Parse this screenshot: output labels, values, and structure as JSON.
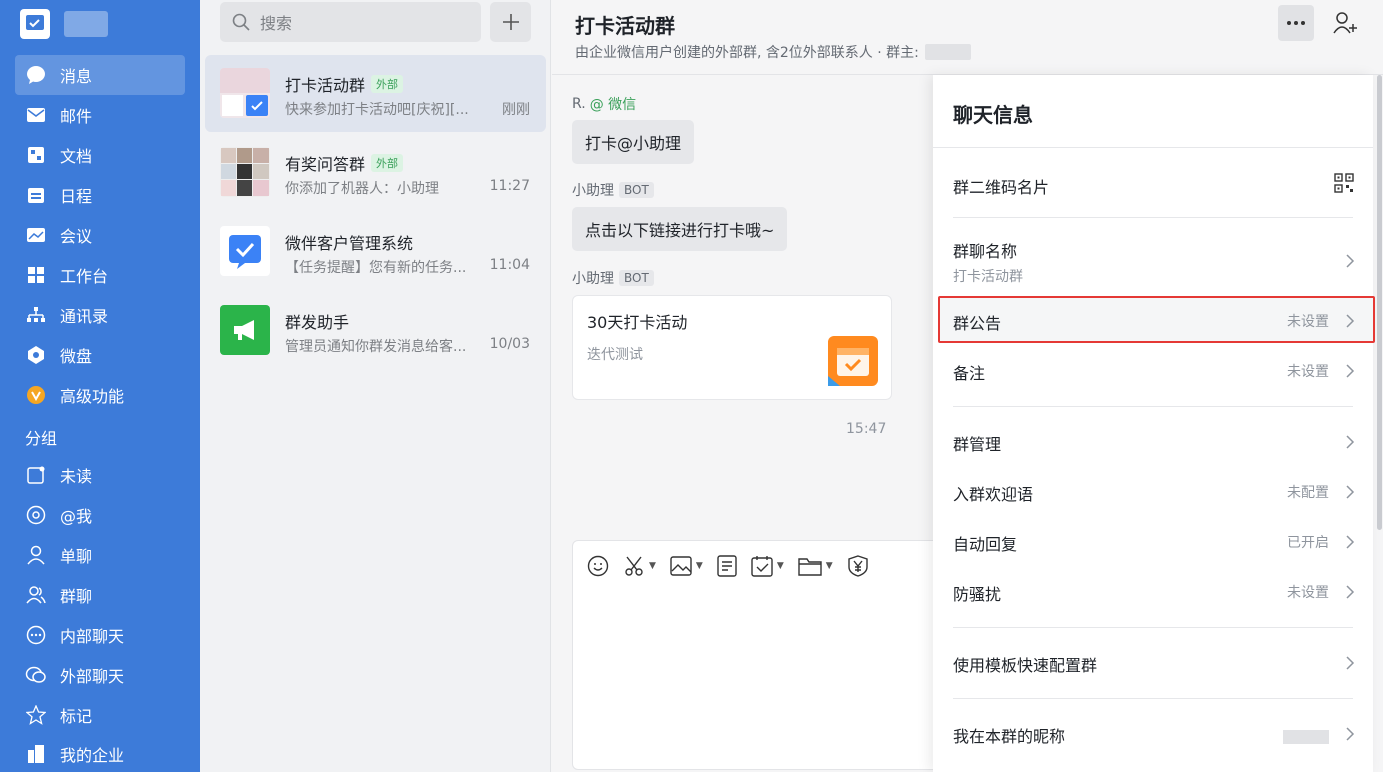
{
  "colors": {
    "sidebar": "#3d7bd9",
    "accent_green": "#3aa05a",
    "highlight_border": "#e53935"
  },
  "sidebar": {
    "nav": [
      {
        "label": "消息",
        "icon": "chat-bubble-icon"
      },
      {
        "label": "邮件",
        "icon": "mail-icon"
      },
      {
        "label": "文档",
        "icon": "document-icon"
      },
      {
        "label": "日程",
        "icon": "calendar-icon"
      },
      {
        "label": "会议",
        "icon": "meeting-icon"
      },
      {
        "label": "工作台",
        "icon": "grid-icon"
      },
      {
        "label": "通讯录",
        "icon": "org-chart-icon"
      },
      {
        "label": "微盘",
        "icon": "drive-icon"
      },
      {
        "label": "高级功能",
        "icon": "premium-icon"
      }
    ],
    "group_label": "分组",
    "groups": [
      {
        "label": "未读",
        "icon": "unread-icon"
      },
      {
        "label": "@我",
        "icon": "at-icon"
      },
      {
        "label": "单聊",
        "icon": "person-icon"
      },
      {
        "label": "群聊",
        "icon": "group-icon"
      },
      {
        "label": "内部聊天",
        "icon": "dots-chat-icon"
      },
      {
        "label": "外部聊天",
        "icon": "external-chat-icon"
      },
      {
        "label": "标记",
        "icon": "star-icon"
      },
      {
        "label": "我的企业",
        "icon": "building-icon"
      }
    ]
  },
  "convlist": {
    "search_placeholder": "搜索",
    "items": [
      {
        "name": "打卡活动群",
        "tag": "外部",
        "preview": "快来参加打卡活动吧[庆祝][...",
        "time": "刚刚"
      },
      {
        "name": "有奖问答群",
        "tag": "外部",
        "preview": "你添加了机器人：小助理",
        "time": "11:27"
      },
      {
        "name": "微伴客户管理系统",
        "tag": "",
        "preview": "【任务提醒】您有新的任务...",
        "time": "11:04"
      },
      {
        "name": "群发助手",
        "tag": "",
        "preview": "管理员通知你群发消息给客...",
        "time": "10/03"
      }
    ]
  },
  "chat": {
    "title": "打卡活动群",
    "subtitle": "由企业微信用户创建的外部群, 含2位外部联系人 · 群主:",
    "messages": [
      {
        "sender": "R.",
        "source": "@ 微信",
        "text": "打卡@小助理"
      },
      {
        "sender": "小助理",
        "badge": "BOT",
        "text": "点击以下链接进行打卡哦~"
      },
      {
        "sender": "小助理",
        "badge": "BOT",
        "card_title": "30天打卡活动",
        "card_desc": "迭代测试"
      }
    ],
    "time": "15:47"
  },
  "panel": {
    "title": "聊天信息",
    "rows": {
      "qr": {
        "label": "群二维码名片"
      },
      "name": {
        "label": "群聊名称",
        "value": "打卡活动群"
      },
      "notice": {
        "label": "群公告",
        "value": "未设置"
      },
      "remark": {
        "label": "备注",
        "value": "未设置"
      },
      "manage": {
        "label": "群管理"
      },
      "welcome": {
        "label": "入群欢迎语",
        "value": "未配置"
      },
      "autoreply": {
        "label": "自动回复",
        "value": "已开启"
      },
      "antispam": {
        "label": "防骚扰",
        "value": "未设置"
      },
      "template": {
        "label": "使用模板快速配置群"
      },
      "nickname": {
        "label": "我在本群的昵称"
      }
    }
  }
}
